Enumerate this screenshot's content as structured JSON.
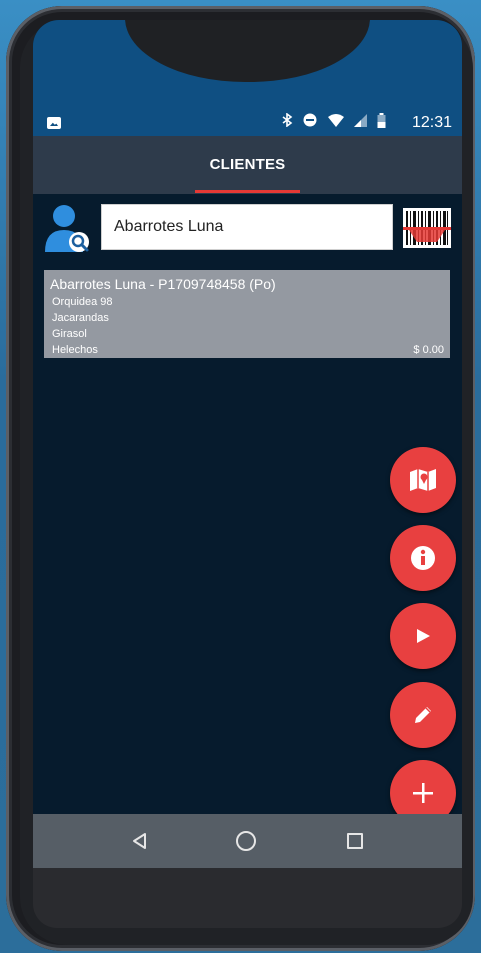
{
  "status_bar": {
    "time": "12:31",
    "icons": [
      "gallery-icon",
      "bluetooth-icon",
      "do-not-disturb-icon",
      "wifi-icon",
      "signal-icon",
      "battery-icon"
    ]
  },
  "header": {
    "title": "CLIENTES",
    "accent_color": "#e53935"
  },
  "search": {
    "value": "Abarrotes Luna"
  },
  "client_card": {
    "title": "Abarrotes Luna - P1709748458 (Po)",
    "address_lines": [
      "Orquidea 98",
      "Jacarandas",
      "Girasol",
      "Helechos"
    ],
    "total": "$ 0.00"
  },
  "fabs": [
    {
      "name": "map-button",
      "icon": "map-icon"
    },
    {
      "name": "info-button",
      "icon": "info-icon"
    },
    {
      "name": "play-button",
      "icon": "play-icon"
    },
    {
      "name": "edit-button",
      "icon": "pencil-icon"
    },
    {
      "name": "add-button",
      "icon": "plus-icon"
    }
  ],
  "fab_color": "#e84040",
  "navigation": [
    "back-icon",
    "home-icon",
    "recent-apps-icon"
  ]
}
